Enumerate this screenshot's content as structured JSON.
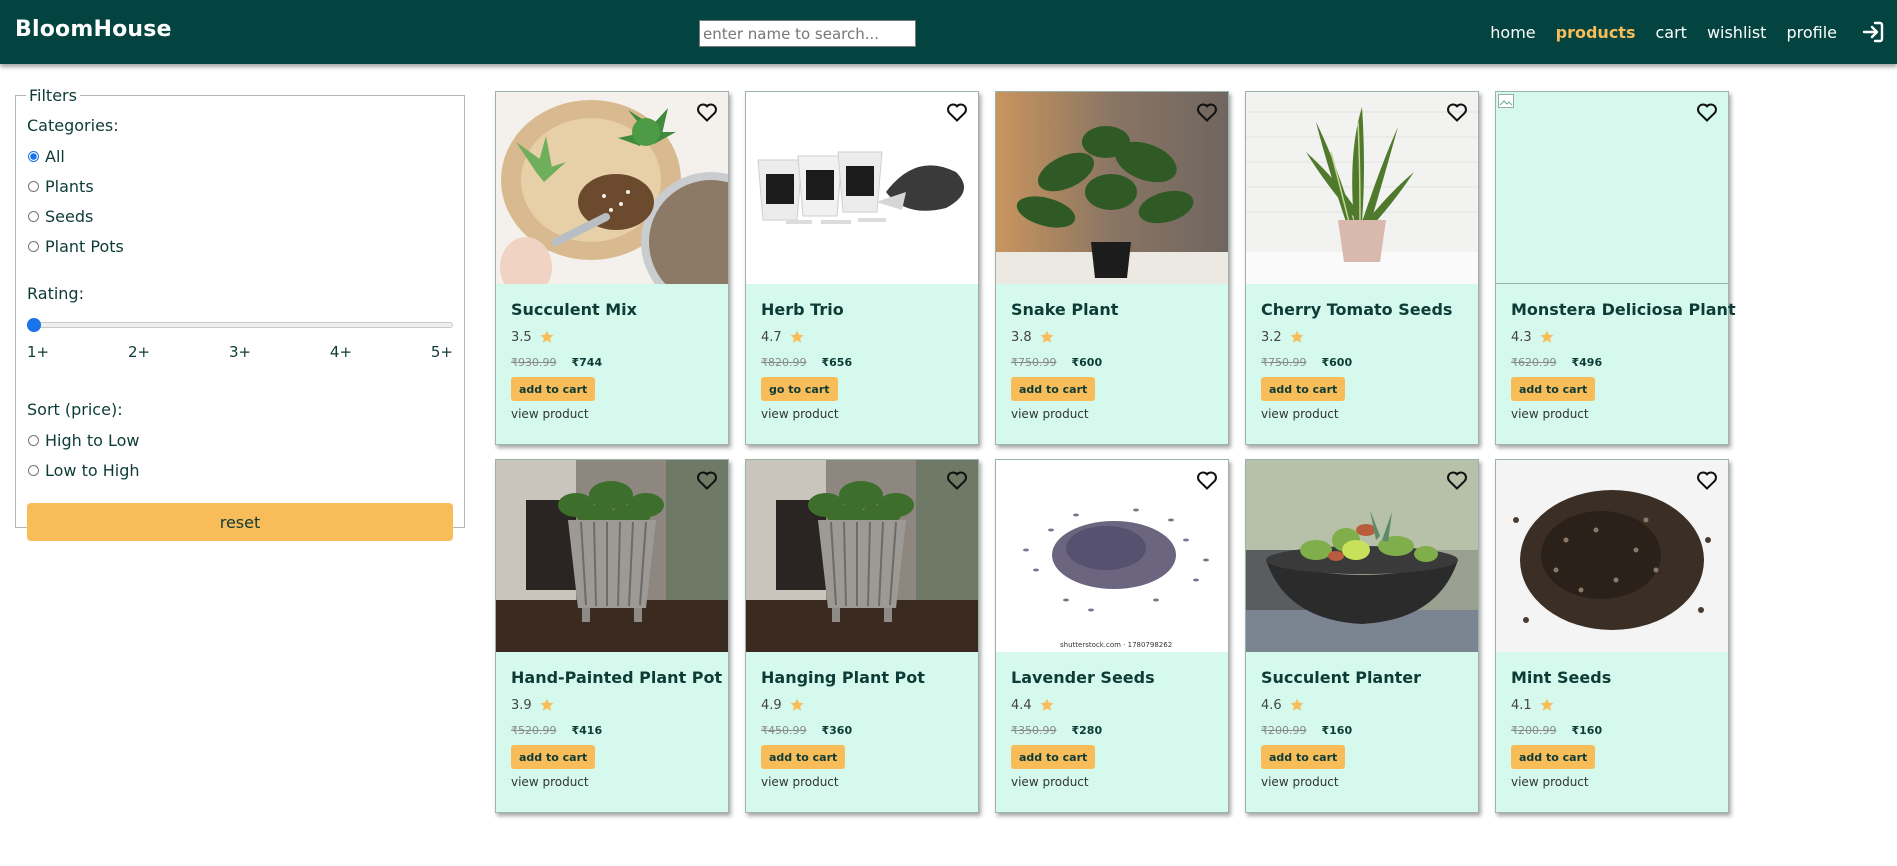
{
  "brand": {
    "name": "BloomHouse"
  },
  "search": {
    "placeholder": "enter name to search..."
  },
  "nav": {
    "items": [
      {
        "label": "home",
        "active": false
      },
      {
        "label": "products",
        "active": true
      },
      {
        "label": "cart",
        "active": false
      },
      {
        "label": "wishlist",
        "active": false
      },
      {
        "label": "profile",
        "active": false
      }
    ],
    "login_icon": "login-icon"
  },
  "filters": {
    "legend": "Filters",
    "categories_heading": "Categories:",
    "categories": [
      "All",
      "Plants",
      "Seeds",
      "Plant Pots"
    ],
    "selected_category": "All",
    "rating_heading": "Rating:",
    "rating_ticks": [
      "1+",
      "2+",
      "3+",
      "4+",
      "5+"
    ],
    "rating_value": "1+",
    "sort_heading": "Sort (price):",
    "sort_options": [
      "High to Low",
      "Low to High"
    ],
    "reset_label": "reset"
  },
  "colors": {
    "header_bg": "#034440",
    "accent": "#f8bd59",
    "card_bg": "#d5faed",
    "star": "#f8bd59"
  },
  "products": [
    {
      "name": "Succulent Mix",
      "rating": "3.5",
      "old_price": "₹930.99",
      "price": "₹744",
      "button": "add to cart",
      "link": "view product",
      "image": "succulents"
    },
    {
      "name": "Herb Trio",
      "rating": "4.7",
      "old_price": "₹820.99",
      "price": "₹656",
      "button": "go to cart",
      "link": "view product",
      "image": "pots-kit"
    },
    {
      "name": "Snake Plant",
      "rating": "3.8",
      "old_price": "₹750.99",
      "price": "₹600",
      "button": "add to cart",
      "link": "view product",
      "image": "leafy-plant"
    },
    {
      "name": "Cherry Tomato Seeds",
      "rating": "3.2",
      "old_price": "₹750.99",
      "price": "₹600",
      "button": "add to cart",
      "link": "view product",
      "image": "snake-plant"
    },
    {
      "name": "Monstera Deliciosa Plant",
      "rating": "4.3",
      "old_price": "₹620.99",
      "price": "₹496",
      "button": "add to cart",
      "link": "view product",
      "image": "broken"
    },
    {
      "name": "Hand-Painted Plant Pot",
      "rating": "3.9",
      "old_price": "₹520.99",
      "price": "₹416",
      "button": "add to cart",
      "link": "view product",
      "image": "silver-pot"
    },
    {
      "name": "Hanging Plant Pot",
      "rating": "4.9",
      "old_price": "₹450.99",
      "price": "₹360",
      "button": "add to cart",
      "link": "view product",
      "image": "silver-pot"
    },
    {
      "name": "Lavender Seeds",
      "rating": "4.4",
      "old_price": "₹350.99",
      "price": "₹280",
      "button": "add to cart",
      "link": "view product",
      "image": "lavender-seeds"
    },
    {
      "name": "Succulent Planter",
      "rating": "4.6",
      "old_price": "₹200.99",
      "price": "₹160",
      "button": "add to cart",
      "link": "view product",
      "image": "planter-bowl"
    },
    {
      "name": "Mint Seeds",
      "rating": "4.1",
      "old_price": "₹200.99",
      "price": "₹160",
      "button": "add to cart",
      "link": "view product",
      "image": "dark-seeds"
    }
  ],
  "image_watermarks": {
    "lavender-seeds": "shutterstock.com · 1780798262"
  }
}
